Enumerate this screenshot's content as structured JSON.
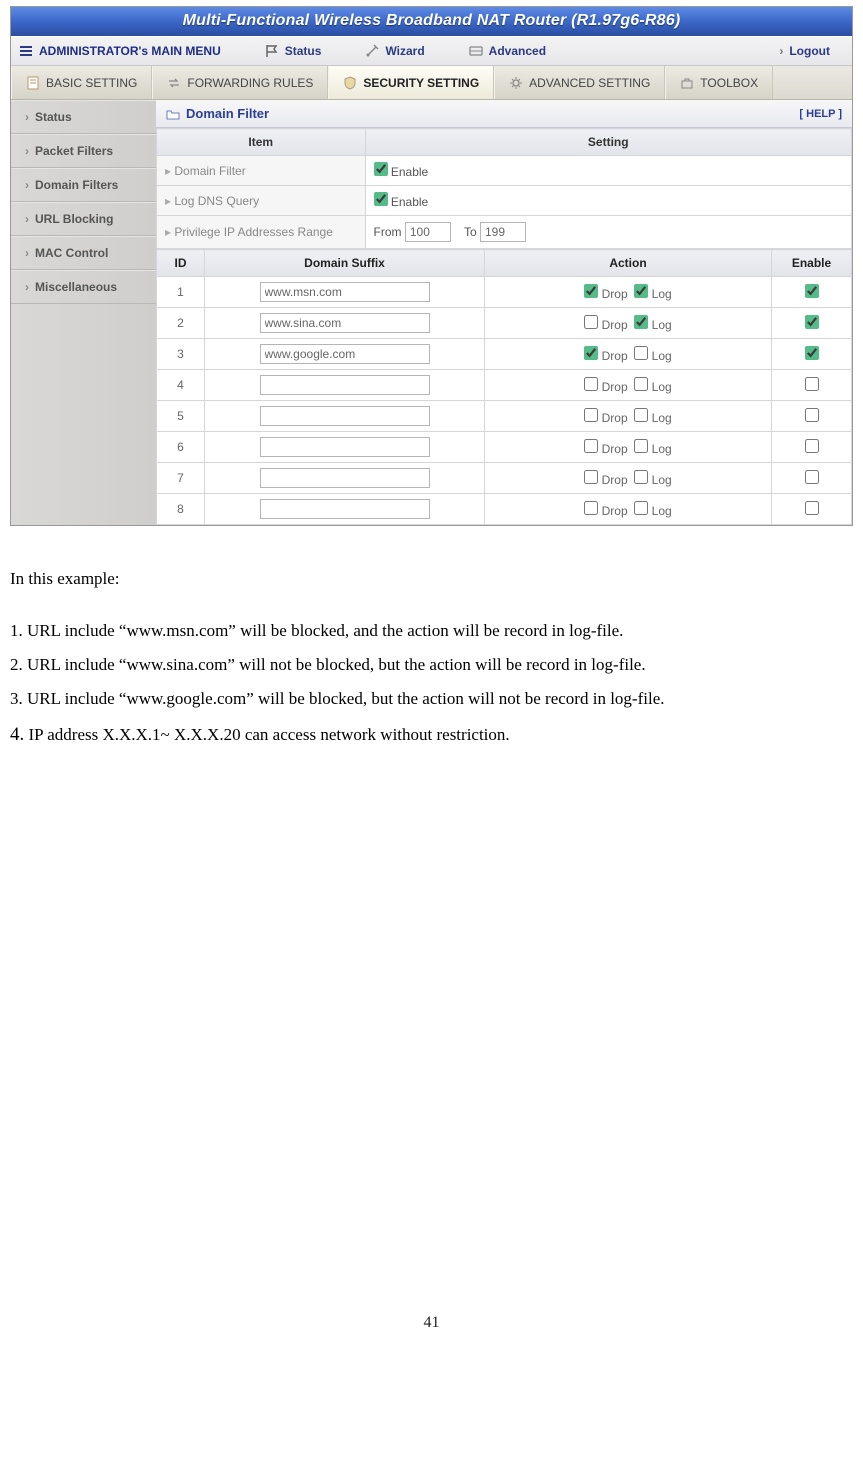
{
  "title": "Multi-Functional Wireless Broadband NAT Router (R1.97g6-R86)",
  "mainmenu": {
    "label": "ADMINISTRATOR's MAIN MENU",
    "status": "Status",
    "wizard": "Wizard",
    "advanced": "Advanced",
    "logout": "Logout"
  },
  "subtabs": {
    "basic": "BASIC SETTING",
    "forwarding": "FORWARDING RULES",
    "security": "SECURITY SETTING",
    "advanced": "ADVANCED SETTING",
    "toolbox": "TOOLBOX"
  },
  "sidebar": {
    "status": "Status",
    "packet_filters": "Packet Filters",
    "domain_filters": "Domain Filters",
    "url_blocking": "URL Blocking",
    "mac_control": "MAC Control",
    "miscellaneous": "Miscellaneous"
  },
  "panel": {
    "title": "Domain Filter",
    "help": "[ HELP ]",
    "headers": {
      "item": "Item",
      "setting": "Setting"
    },
    "rows": {
      "domain_filter": "Domain Filter",
      "log_dns": "Log DNS Query",
      "priv_ip": "Privilege IP Addresses Range",
      "enable": "Enable",
      "from": "From",
      "to": "To",
      "from_val": "100",
      "to_val": "199"
    },
    "rules_headers": {
      "id": "ID",
      "suffix": "Domain Suffix",
      "action": "Action",
      "enable": "Enable",
      "drop": "Drop",
      "log": "Log"
    },
    "rules": [
      {
        "id": "1",
        "suffix": "www.msn.com",
        "drop": true,
        "log": true,
        "enable": true
      },
      {
        "id": "2",
        "suffix": "www.sina.com",
        "drop": false,
        "log": true,
        "enable": true
      },
      {
        "id": "3",
        "suffix": "www.google.com",
        "drop": true,
        "log": false,
        "enable": true
      },
      {
        "id": "4",
        "suffix": "",
        "drop": false,
        "log": false,
        "enable": false
      },
      {
        "id": "5",
        "suffix": "",
        "drop": false,
        "log": false,
        "enable": false
      },
      {
        "id": "6",
        "suffix": "",
        "drop": false,
        "log": false,
        "enable": false
      },
      {
        "id": "7",
        "suffix": "",
        "drop": false,
        "log": false,
        "enable": false
      },
      {
        "id": "8",
        "suffix": "",
        "drop": false,
        "log": false,
        "enable": false
      }
    ]
  },
  "doc": {
    "intro": "In this example:",
    "l1": "1. URL include “www.msn.com” will be blocked, and the action will be record in log-file.",
    "l2": "2. URL include “www.sina.com” will not be blocked, but the action will be record in log-file.",
    "l3": "3. URL include “www.google.com” will be blocked, but the action will not be record in log-file.",
    "l4_n": "4.",
    "l4": " IP address X.X.X.1~ X.X.X.20 can access network without restriction."
  },
  "page_number": "41"
}
